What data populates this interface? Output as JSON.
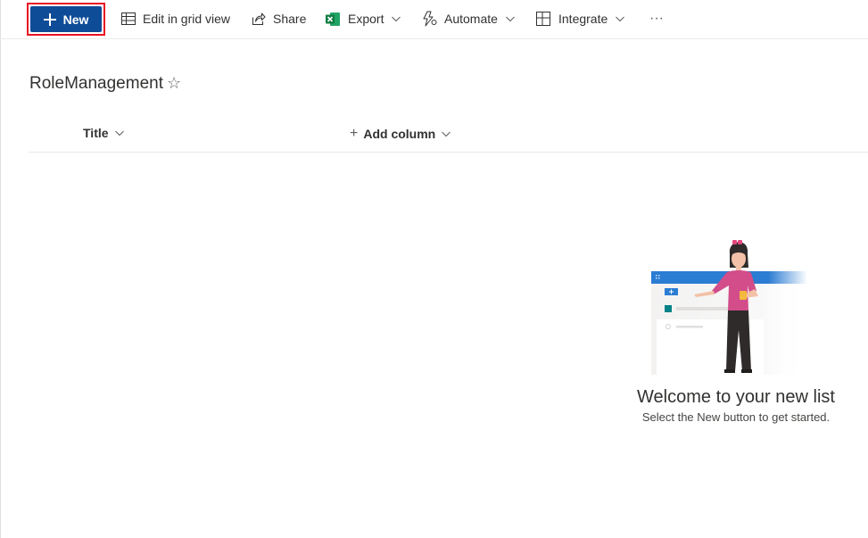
{
  "toolbar": {
    "new_label": "New",
    "edit_grid_label": "Edit in grid view",
    "share_label": "Share",
    "export_label": "Export",
    "automate_label": "Automate",
    "integrate_label": "Integrate",
    "more_label": "···"
  },
  "list": {
    "title": "RoleManagement",
    "columns": [
      "Title",
      "Add column"
    ]
  },
  "empty_state": {
    "heading": "Welcome to your new list",
    "hint": "Select the New button to get started."
  },
  "colors": {
    "accent": "#0f4c97",
    "highlight_border": "#e81123",
    "excel_green": "#107c41"
  },
  "icons": [
    "plus-icon",
    "grid-icon",
    "share-icon",
    "excel-icon",
    "automate-icon",
    "integrate-icon",
    "more-icon",
    "star-icon",
    "chevron-down-icon"
  ]
}
